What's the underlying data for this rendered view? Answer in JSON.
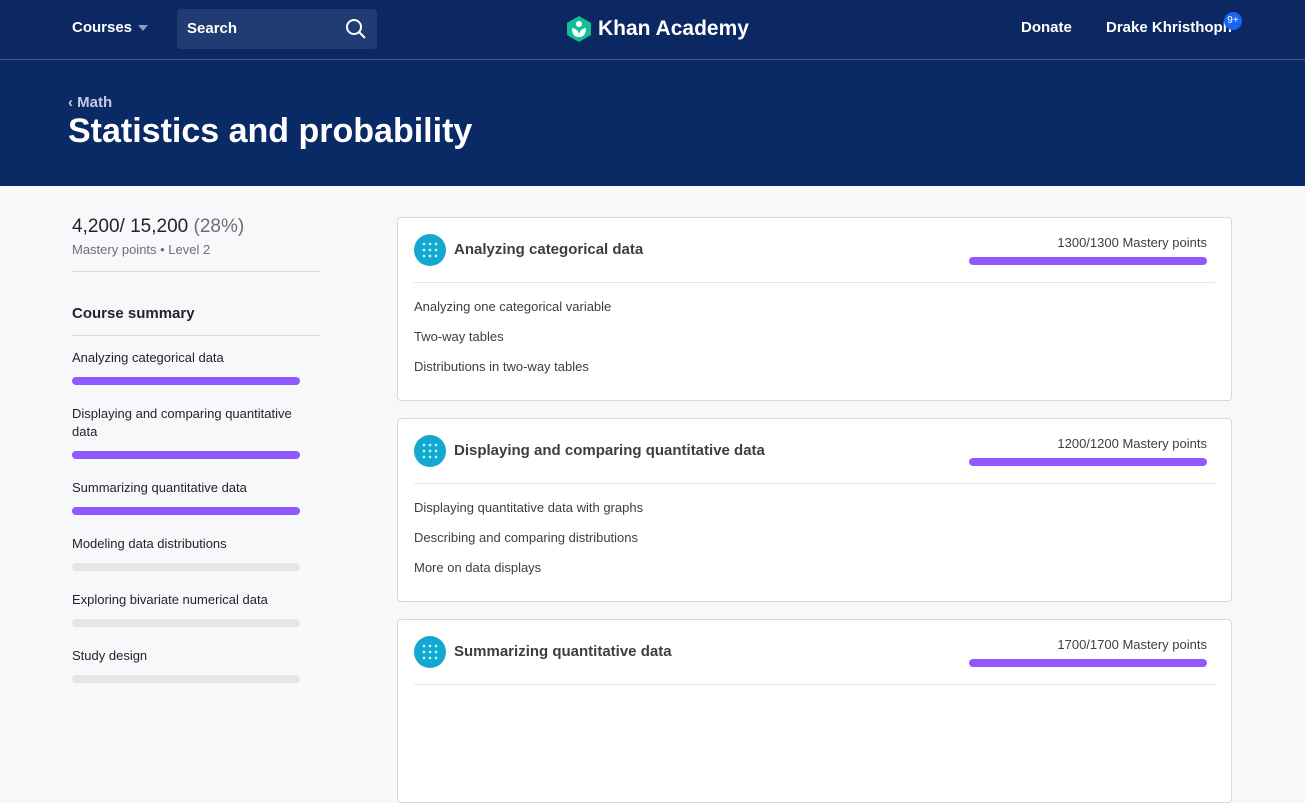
{
  "nav": {
    "courses": "Courses",
    "search_placeholder": "Search",
    "logo": "Khan Academy",
    "donate": "Donate",
    "user": "Drake Khristhoph",
    "badge": "9+"
  },
  "hero": {
    "back": "Math",
    "title": "Statistics and probability"
  },
  "sidebar": {
    "points": "4,200/ 15,200",
    "percent": "(28%)",
    "sub": "Mastery points • Level 2",
    "summary_title": "Course summary",
    "items": [
      {
        "label": "Analyzing categorical data",
        "progress": 1
      },
      {
        "label": "Displaying and comparing quantitative data",
        "progress": 1
      },
      {
        "label": "Summarizing quantitative data",
        "progress": 1
      },
      {
        "label": "Modeling data distributions",
        "progress": 0
      },
      {
        "label": "Exploring bivariate numerical data",
        "progress": 0
      },
      {
        "label": "Study design",
        "progress": 0
      }
    ]
  },
  "units": [
    {
      "title": "Analyzing categorical data",
      "points": "1300/1300 Mastery points",
      "progress": 1,
      "lessons": [
        "Analyzing one categorical variable",
        "Two-way tables",
        "Distributions in two-way tables"
      ]
    },
    {
      "title": "Displaying and comparing quantitative data",
      "points": "1200/1200 Mastery points",
      "progress": 1,
      "lessons": [
        "Displaying quantitative data with graphs",
        "Describing and comparing distributions",
        "More on data displays"
      ]
    },
    {
      "title": "Summarizing quantitative data",
      "points": "1700/1700 Mastery points",
      "progress": 1,
      "lessons": []
    }
  ]
}
